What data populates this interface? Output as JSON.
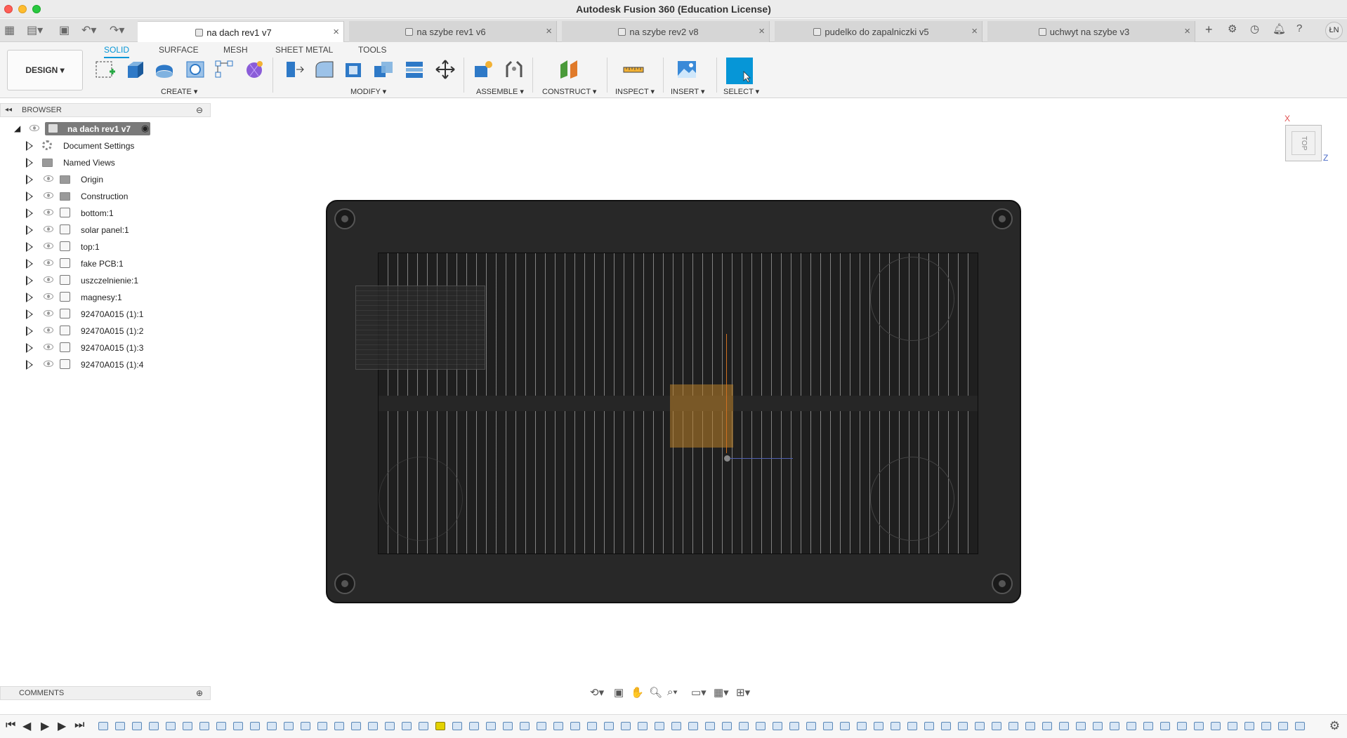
{
  "window": {
    "title": "Autodesk Fusion 360 (Education License)"
  },
  "tabs": [
    {
      "label": "na dach rev1 v7",
      "active": true
    },
    {
      "label": "na szybe rev1 v6",
      "active": false
    },
    {
      "label": "na szybe rev2 v8",
      "active": false
    },
    {
      "label": "pudelko do zapalniczki v5",
      "active": false
    },
    {
      "label": "uchwyt na szybe v3",
      "active": false
    }
  ],
  "user": {
    "initials": "ŁN"
  },
  "ribbon": {
    "workspace": "DESIGN ▾",
    "tabs": [
      "SOLID",
      "SURFACE",
      "MESH",
      "SHEET METAL",
      "TOOLS"
    ],
    "active_tab": "SOLID",
    "groups": {
      "create": "CREATE ▾",
      "modify": "MODIFY ▾",
      "assemble": "ASSEMBLE ▾",
      "construct": "CONSTRUCT ▾",
      "inspect": "INSPECT ▾",
      "insert": "INSERT ▾",
      "select": "SELECT ▾"
    }
  },
  "browser": {
    "title": "BROWSER",
    "root": "na dach rev1 v7",
    "items": [
      {
        "label": "Document Settings",
        "icon": "gear-icon"
      },
      {
        "label": "Named Views",
        "icon": "folder-icon"
      },
      {
        "label": "Origin",
        "icon": "folder-icon"
      },
      {
        "label": "Construction",
        "icon": "folder-icon"
      },
      {
        "label": "bottom:1",
        "icon": "component-icon"
      },
      {
        "label": "solar panel:1",
        "icon": "component-icon"
      },
      {
        "label": "top:1",
        "icon": "component-icon"
      },
      {
        "label": "fake PCB:1",
        "icon": "component-icon"
      },
      {
        "label": "uszczelnienie:1",
        "icon": "component-icon"
      },
      {
        "label": "magnesy:1",
        "icon": "component-icon"
      },
      {
        "label": "92470A015 (1):1",
        "icon": "component-icon"
      },
      {
        "label": "92470A015 (1):2",
        "icon": "component-icon"
      },
      {
        "label": "92470A015 (1):3",
        "icon": "component-icon"
      },
      {
        "label": "92470A015 (1):4",
        "icon": "component-icon"
      }
    ]
  },
  "viewcube": {
    "face": "TOP",
    "axis_x": "X",
    "axis_z": "Z"
  },
  "comments": {
    "title": "COMMENTS"
  },
  "colors": {
    "accent": "#0696d7",
    "timeline_selected": "#e3d200"
  }
}
